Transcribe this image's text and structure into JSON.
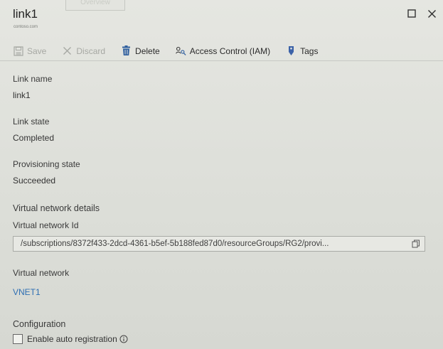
{
  "header": {
    "title": "link1",
    "subtitle": "contoso.com",
    "top_tab": "Overview"
  },
  "toolbar": {
    "save_label": "Save",
    "discard_label": "Discard",
    "delete_label": "Delete",
    "iam_label": "Access Control (IAM)",
    "tags_label": "Tags"
  },
  "fields": {
    "link_name": {
      "label": "Link name",
      "value": "link1"
    },
    "link_state": {
      "label": "Link state",
      "value": "Completed"
    },
    "provisioning_state": {
      "label": "Provisioning state",
      "value": "Succeeded"
    },
    "vnet_details_heading": "Virtual network details",
    "vnet_id": {
      "label": "Virtual network Id",
      "value": "/subscriptions/8372f433-2dcd-4361-b5ef-5b188fed87d0/resourceGroups/RG2/provi..."
    },
    "vnet": {
      "label": "Virtual network",
      "value": "VNET1"
    },
    "configuration_heading": "Configuration",
    "auto_registration_label": "Enable auto registration"
  },
  "colors": {
    "link": "#2f6fb3",
    "delete_icon": "#2f5f9e",
    "tags_icon": "#3b62a8"
  }
}
